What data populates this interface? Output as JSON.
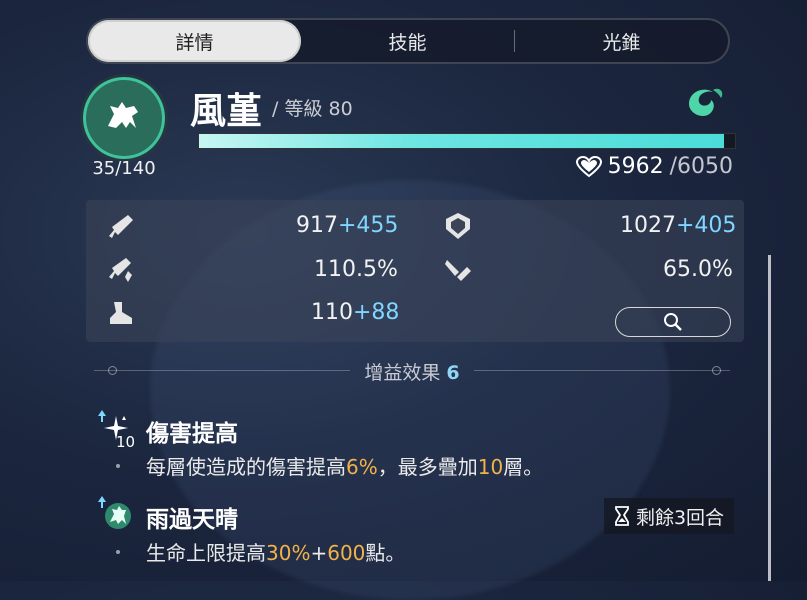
{
  "tabs": [
    {
      "label": "詳情",
      "active": true
    },
    {
      "label": "技能",
      "active": false
    },
    {
      "label": "光錐",
      "active": false
    }
  ],
  "character": {
    "name": "風堇",
    "level_text": "/ 等級 80",
    "exp_text": "35/140",
    "hp_current": "5962",
    "hp_max": "/6050",
    "emblem_icon": "white-horse-icon",
    "element_icon": "wind-element-icon",
    "hp_fill_fraction": 0.98
  },
  "stats": {
    "atk_base": "917",
    "atk_add": "+455",
    "def_base": "1027",
    "def_add": "+405",
    "crit_dmg": "110.5%",
    "effect_res": "65.0%",
    "speed_base": "110",
    "speed_add": "+88"
  },
  "buffs": {
    "title": "增益效果",
    "count": "6",
    "items": [
      {
        "name": "傷害提高",
        "icon_badge": "10",
        "desc_parts": [
          "每層使造成的傷害提高",
          "6%",
          "，最多疊加",
          "10",
          "層。"
        ]
      },
      {
        "name": "雨過天晴",
        "desc_parts": [
          "生命上限提高",
          "30%",
          "+",
          "600",
          "點。"
        ],
        "remaining": "剩餘3回合"
      }
    ]
  },
  "colors": {
    "accent_cyan": "#6ee6e2",
    "stat_add": "#7fd6ff",
    "highlight": "#f2b14a"
  }
}
